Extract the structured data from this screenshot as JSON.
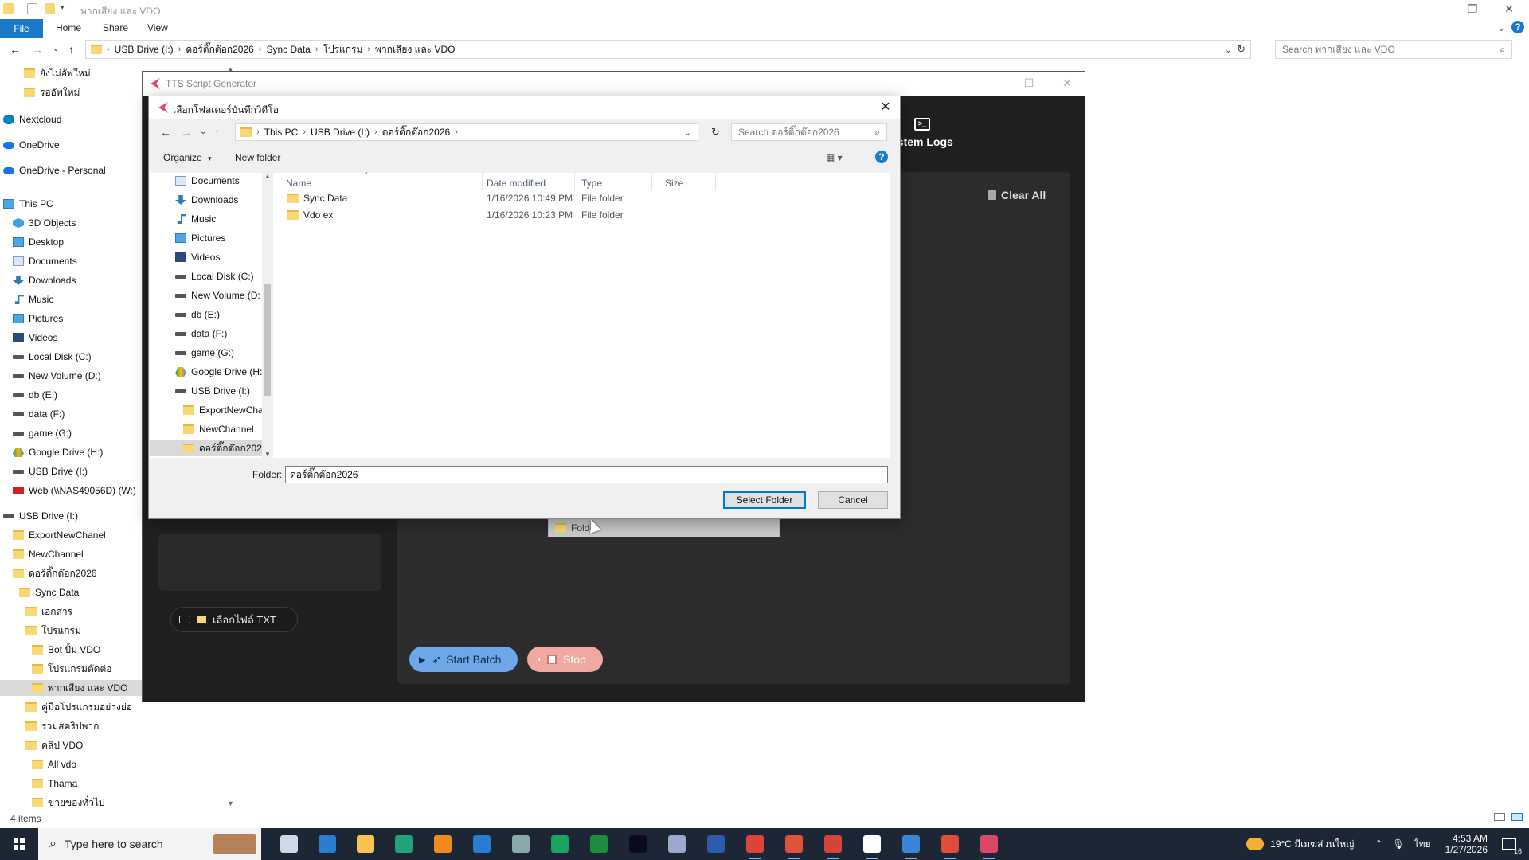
{
  "explorer": {
    "title": "พากเสียง และ VDO",
    "ribbon_tabs": [
      "File",
      "Home",
      "Share",
      "View"
    ],
    "breadcrumbs": [
      "USB Drive (I:)",
      "ดอร์ติ๊กต๊อก2026",
      "Sync Data",
      "โปรแกรม",
      "พากเสียง และ VDO"
    ],
    "search_placeholder": "Search พากเสียง และ VDO",
    "status": "4 items",
    "nav_items": [
      {
        "label": "ยังไม่อัพใหม่",
        "icon": "folder-icon"
      },
      {
        "label": "รออัพใหม่",
        "icon": "folder-icon"
      },
      {
        "label": "Nextcloud",
        "icon": "nextcloud-icon"
      },
      {
        "label": "OneDrive",
        "icon": "cloud-icon"
      },
      {
        "label": "OneDrive - Personal",
        "icon": "cloud-icon"
      },
      {
        "label": "This PC",
        "icon": "computer-icon"
      },
      {
        "label": "3D Objects",
        "icon": "3d-objects-icon"
      },
      {
        "label": "Desktop",
        "icon": "desktop-icon"
      },
      {
        "label": "Documents",
        "icon": "documents-icon"
      },
      {
        "label": "Downloads",
        "icon": "downloads-icon"
      },
      {
        "label": "Music",
        "icon": "music-icon"
      },
      {
        "label": "Pictures",
        "icon": "pictures-icon"
      },
      {
        "label": "Videos",
        "icon": "videos-icon"
      },
      {
        "label": "Local Disk (C:)",
        "icon": "drive-icon"
      },
      {
        "label": "New Volume (D:)",
        "icon": "drive-icon"
      },
      {
        "label": "db (E:)",
        "icon": "drive-icon"
      },
      {
        "label": "data (F:)",
        "icon": "drive-icon"
      },
      {
        "label": "game (G:)",
        "icon": "drive-icon"
      },
      {
        "label": "Google Drive (H:)",
        "icon": "google-drive-icon"
      },
      {
        "label": "USB Drive (I:)",
        "icon": "drive-icon"
      },
      {
        "label": "Web (\\\\NAS49056D) (W:)",
        "icon": "network-drive-icon"
      },
      {
        "label": "USB Drive (I:)",
        "icon": "drive-icon"
      },
      {
        "label": "ExportNewChanel",
        "icon": "folder-icon"
      },
      {
        "label": "NewChannel",
        "icon": "folder-icon"
      },
      {
        "label": "ดอร์ติ๊กต๊อก2026",
        "icon": "folder-icon"
      },
      {
        "label": "Sync Data",
        "icon": "folder-icon"
      },
      {
        "label": "เอกสาร",
        "icon": "folder-icon"
      },
      {
        "label": "โปรแกรม",
        "icon": "folder-icon"
      },
      {
        "label": "Bot ปั้ม VDO",
        "icon": "folder-icon"
      },
      {
        "label": "โปรแกรมตัดต่อ",
        "icon": "folder-icon"
      },
      {
        "label": "พากเสียง และ VDO",
        "icon": "folder-icon"
      },
      {
        "label": "คู่มือโปรแกรมอย่างย่อ",
        "icon": "folder-icon"
      },
      {
        "label": "รวมสคริปพาก",
        "icon": "folder-icon"
      },
      {
        "label": "คลิป VDO",
        "icon": "folder-icon"
      },
      {
        "label": "All vdo",
        "icon": "folder-icon"
      },
      {
        "label": "Thama",
        "icon": "folder-icon"
      },
      {
        "label": "ขายของทั่วไป",
        "icon": "folder-icon"
      }
    ]
  },
  "tts_app": {
    "title": "TTS Script Generator",
    "logs_tab": "ystem Logs",
    "clear_all": "Clear All",
    "pick_txt": "เลือกไฟล์ TXT",
    "start_batch": "Start Batch",
    "stop": "Stop",
    "drag_label": "Folder"
  },
  "dialog": {
    "title": "เลือกโฟลเดอร์บันทึกวิดีโอ",
    "breadcrumbs": [
      "This PC",
      "USB Drive (I:)",
      "ดอร์ติ๊กต๊อก2026"
    ],
    "search_placeholder": "Search ดอร์ติ๊กต๊อก2026",
    "organize": "Organize",
    "new_folder": "New folder",
    "tree": [
      {
        "label": "Documents",
        "icon": "documents-icon"
      },
      {
        "label": "Downloads",
        "icon": "downloads-icon"
      },
      {
        "label": "Music",
        "icon": "music-icon"
      },
      {
        "label": "Pictures",
        "icon": "pictures-icon"
      },
      {
        "label": "Videos",
        "icon": "videos-icon"
      },
      {
        "label": "Local Disk (C:)",
        "icon": "drive-icon"
      },
      {
        "label": "New Volume (D:",
        "icon": "drive-icon"
      },
      {
        "label": "db (E:)",
        "icon": "drive-icon"
      },
      {
        "label": "data (F:)",
        "icon": "drive-icon"
      },
      {
        "label": "game (G:)",
        "icon": "drive-icon"
      },
      {
        "label": "Google Drive (H:",
        "icon": "google-drive-icon"
      },
      {
        "label": "USB Drive (I:)",
        "icon": "drive-icon"
      },
      {
        "label": "ExportNewCha",
        "icon": "folder-icon"
      },
      {
        "label": "NewChannel",
        "icon": "folder-icon"
      },
      {
        "label": "ดอร์ติ๊กต๊อก202",
        "icon": "folder-icon"
      }
    ],
    "columns": [
      "Name",
      "Date modified",
      "Type",
      "Size"
    ],
    "rows": [
      {
        "name": "Sync Data",
        "date": "1/16/2026 10:49 PM",
        "type": "File folder",
        "size": ""
      },
      {
        "name": "Vdo ex",
        "date": "1/16/2026 10:23 PM",
        "type": "File folder",
        "size": ""
      }
    ],
    "folder_label": "Folder:",
    "folder_value": "ดอร์ติ๊กต๊อก2026",
    "select_button": "Select Folder",
    "cancel_button": "Cancel"
  },
  "taskbar": {
    "search_placeholder": "Type here to search",
    "weather": "19°C มีเมฆส่วนใหญ่",
    "lang": "ไทย",
    "time": "4:53 AM",
    "date": "1/27/2026",
    "notifications": "16"
  },
  "colors": {
    "accent": "#0078d7",
    "file_tab": "#1979ca",
    "app_bg": "#1f1f1f",
    "taskbar": "#1c2635",
    "start_batch": "#6ea7e8",
    "stop": "#f0a8a0"
  }
}
